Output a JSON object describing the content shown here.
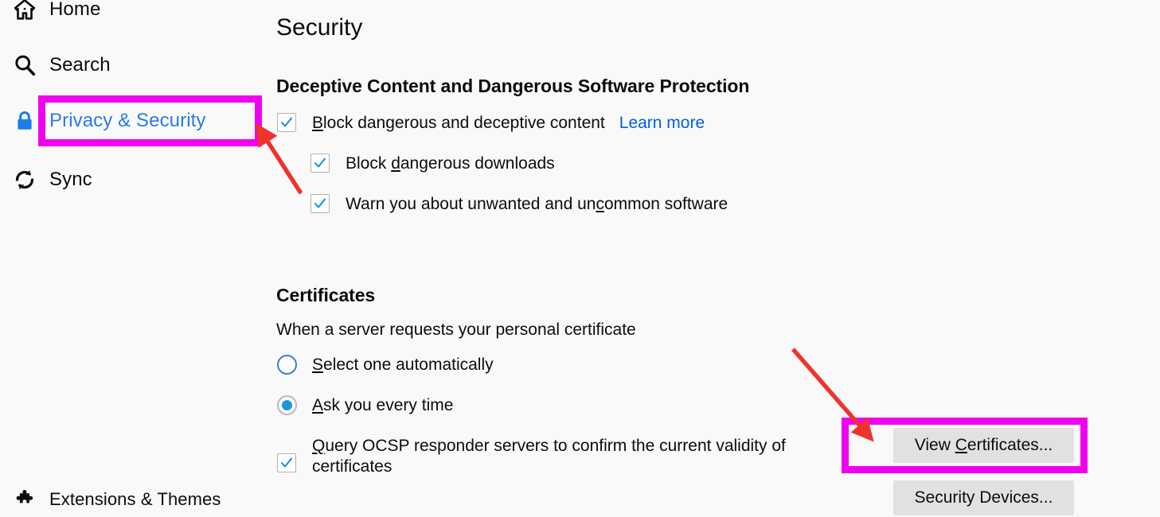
{
  "sidebar": {
    "items": [
      {
        "id": "home",
        "label": "Home",
        "icon": "home-icon",
        "selected": false
      },
      {
        "id": "search",
        "label": "Search",
        "icon": "search-icon",
        "selected": false
      },
      {
        "id": "privacy",
        "label": "Privacy & Security",
        "icon": "lock-icon",
        "selected": true
      },
      {
        "id": "sync",
        "label": "Sync",
        "icon": "sync-icon",
        "selected": false
      },
      {
        "id": "ext",
        "label": "Extensions & Themes",
        "icon": "puzzle-icon",
        "selected": false
      }
    ]
  },
  "main": {
    "page_title": "Security",
    "sections": {
      "deceptive": {
        "heading": "Deceptive Content and Dangerous Software Protection",
        "block_dangerous": {
          "label_pre": "",
          "accesskey": "B",
          "label_post": "lock dangerous and deceptive content",
          "checked": true
        },
        "learn_more": "Learn more",
        "block_downloads": {
          "label_pre": "Block ",
          "accesskey": "d",
          "label_post": "angerous downloads",
          "checked": true
        },
        "warn_unwanted": {
          "label_pre": "Warn you about unwanted and un",
          "accesskey": "c",
          "label_post": "ommon software",
          "checked": true
        }
      },
      "certificates": {
        "heading": "Certificates",
        "description": "When a server requests your personal certificate",
        "select_automatically": {
          "label_pre": "",
          "accesskey": "S",
          "label_post": "elect one automatically",
          "selected": false
        },
        "ask_every_time": {
          "label_pre": "",
          "accesskey": "A",
          "label_post": "sk you every time",
          "selected": true
        },
        "ocsp": {
          "label_pre": "",
          "accesskey": "Q",
          "label_post": "uery OCSP responder servers to confirm the current validity of certificates",
          "checked": true
        },
        "view_certificates_button": "View Certificates...",
        "view_certificates_accesskey": "C",
        "security_devices_button": "Security Devices..."
      }
    }
  },
  "annotations": {
    "highlight_color": "#ef00ef",
    "arrow_color": "#f0322c",
    "highlighted_elements": [
      "Privacy & Security",
      "View Certificates..."
    ],
    "arrows": 2
  },
  "colors": {
    "background": "#f9f9fa",
    "selected_nav_text": "#2b7ae4",
    "link": "#0060df",
    "checkmark": "#1f93e0",
    "button_face": "#e1e1e2"
  }
}
